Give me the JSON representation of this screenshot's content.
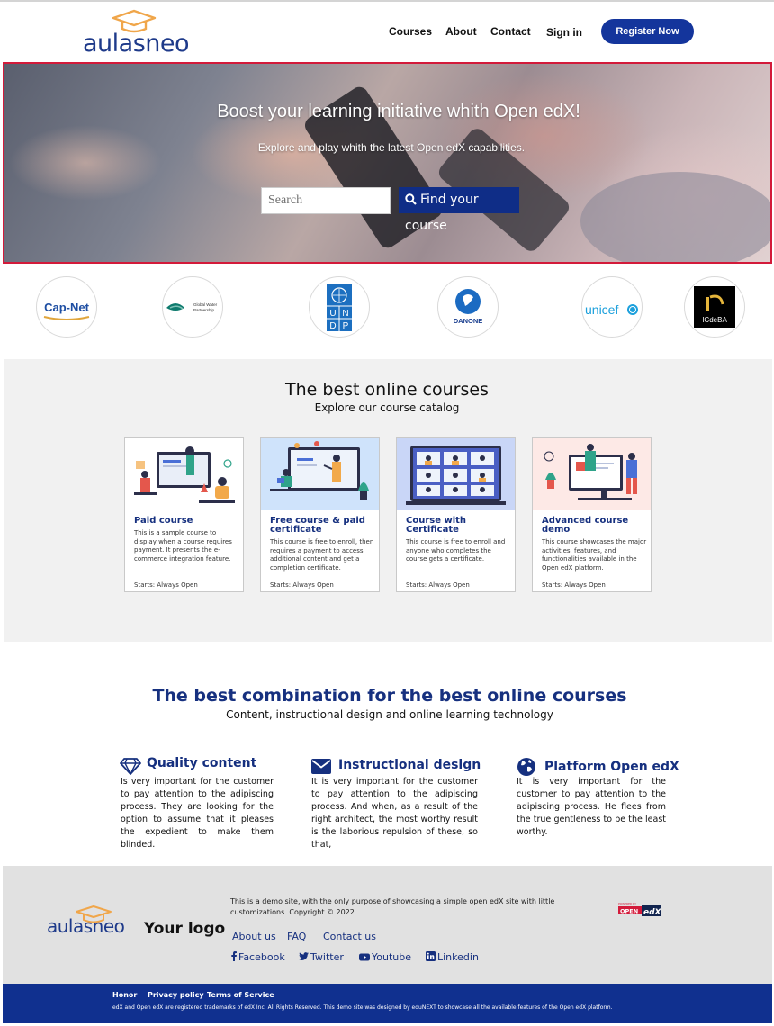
{
  "brand": {
    "logo_text": "aulasneo",
    "primary_color": "#14359c",
    "accent_color": "#f0a64a"
  },
  "nav": {
    "courses": "Courses",
    "about": "About",
    "contact": "Contact",
    "signin": "Sign in",
    "register": "Register Now"
  },
  "hero": {
    "title": "Boost your learning initiative whith Open edX!",
    "subtitle": "Explore and play whith the latest Open edX capabilities.",
    "search_placeholder": "Search",
    "search_button": "Find your course"
  },
  "partners": [
    {
      "name": "Cap-Net"
    },
    {
      "name": "Global Water Partnership"
    },
    {
      "name": "UNDP"
    },
    {
      "name": "DANONE"
    },
    {
      "name": "unicef"
    },
    {
      "name": "ICdeBA"
    }
  ],
  "catalog": {
    "title": "The best online courses",
    "subtitle": "Explore our course catalog",
    "courses": [
      {
        "title": "Paid course",
        "description": "This is a sample course to display when a course requires payment. It presents the e-commerce integration feature.",
        "starts": "Starts: Always Open"
      },
      {
        "title": "Free course & paid certificate",
        "description": "This course is free to enroll, then requires a payment to access additional content and get a completion certificate.",
        "starts": "Starts: Always Open"
      },
      {
        "title": "Course with Certificate",
        "description": "This course is free to enroll and anyone who completes the course gets a certificate.",
        "starts": "Starts: Always Open"
      },
      {
        "title": "Advanced course demo",
        "description": "This course showcases the major activities, features, and functionalities available in the Open edX platform.",
        "starts": "Starts: Always Open"
      }
    ]
  },
  "combination": {
    "title": "The best combination for the best online courses",
    "subtitle": "Content, instructional design and online learning technology",
    "features": [
      {
        "icon": "diamond-icon",
        "title": "Quality content",
        "text": "Is very important for the customer to pay attention to the adipiscing process. They are looking for the option to assume that it pleases the expedient to make them blinded."
      },
      {
        "icon": "envelope-icon",
        "title": "Instructional design",
        "text": "It is very important for the customer to pay attention to the adipiscing process. And when, as a result of the right architect, the most worthy result is the laborious repulsion of these, so that,"
      },
      {
        "icon": "globe-icon",
        "title": "Platform Open edX",
        "text": "It is very important for the customer to pay attention to the adipiscing process. He flees from the true gentleness to be the least worthy."
      }
    ]
  },
  "footer": {
    "logo_text": "aulasneo",
    "your_logo": "Your logo",
    "note": "This is a demo site, with the only purpose of showcasing a simple open edX site with little customizations. Copyright © 2022.",
    "links": {
      "about": "About us",
      "faq": "FAQ",
      "contact": "Contact us"
    },
    "social": {
      "facebook": "Facebook",
      "twitter": "Twitter",
      "youtube": "Youtube",
      "linkedin": "Linkedin"
    },
    "powered_by": "OPEN edX",
    "legal": {
      "honor": "Honor",
      "privacy": "Privacy policy",
      "terms": "Terms of Service"
    },
    "legal_note": "edX and Open edX are registered trademarks of edX Inc. All Rights Reserved. This demo site was designed by eduNEXT to showcase all the available features of the Open edX platform."
  }
}
